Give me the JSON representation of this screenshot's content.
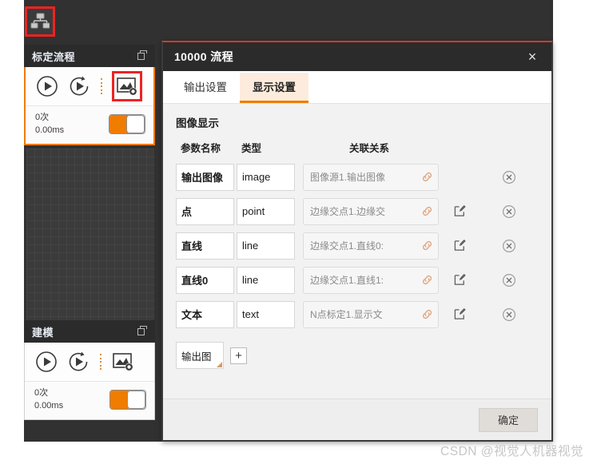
{
  "toolbar": {
    "flow_icon": "hierarchy-icon"
  },
  "panels": [
    {
      "title": "标定流程",
      "dock_icon": "dock-icon",
      "tools": [
        "run-icon",
        "run-loop-icon",
        "image-settings-icon"
      ],
      "count": "0次",
      "time": "0.00ms",
      "toggle_on": true,
      "selected": true,
      "highlight_tool_index": 2
    },
    {
      "title": "建模",
      "dock_icon": "dock-icon",
      "tools": [
        "run-icon",
        "run-loop-icon",
        "image-settings-icon"
      ],
      "count": "0次",
      "time": "0.00ms",
      "toggle_on": true,
      "selected": false,
      "highlight_tool_index": -1
    }
  ],
  "dialog": {
    "title": "10000 流程",
    "close_label": "×",
    "tabs": [
      {
        "label": "输出设置",
        "active": false
      },
      {
        "label": "显示设置",
        "active": true
      }
    ],
    "section_title": "图像显示",
    "table": {
      "headers": [
        "参数名称",
        "类型",
        "关联关系"
      ],
      "rows": [
        {
          "name": "输出图像",
          "type": "image",
          "relation": "图像源1.输出图像",
          "has_edit": false
        },
        {
          "name": "点",
          "type": "point",
          "relation": "边缘交点1.边缘交",
          "has_edit": true
        },
        {
          "name": "直线",
          "type": "line",
          "relation": "边缘交点1.直线0:",
          "has_edit": true
        },
        {
          "name": "直线0",
          "type": "line",
          "relation": "边缘交点1.直线1:",
          "has_edit": true
        },
        {
          "name": "文本",
          "type": "text",
          "relation": "N点标定1.显示文",
          "has_edit": true
        }
      ]
    },
    "add_row": {
      "combo_value": "输出图",
      "add_label": "+"
    },
    "footer": {
      "ok_label": "确定"
    }
  },
  "watermark": "CSDN @视觉人机器视觉",
  "colors": {
    "accent_orange": "#f07c00",
    "highlight_red": "#ef2222",
    "dark_header": "#2b2b2b",
    "dialog_bg": "#f2f2f2"
  }
}
